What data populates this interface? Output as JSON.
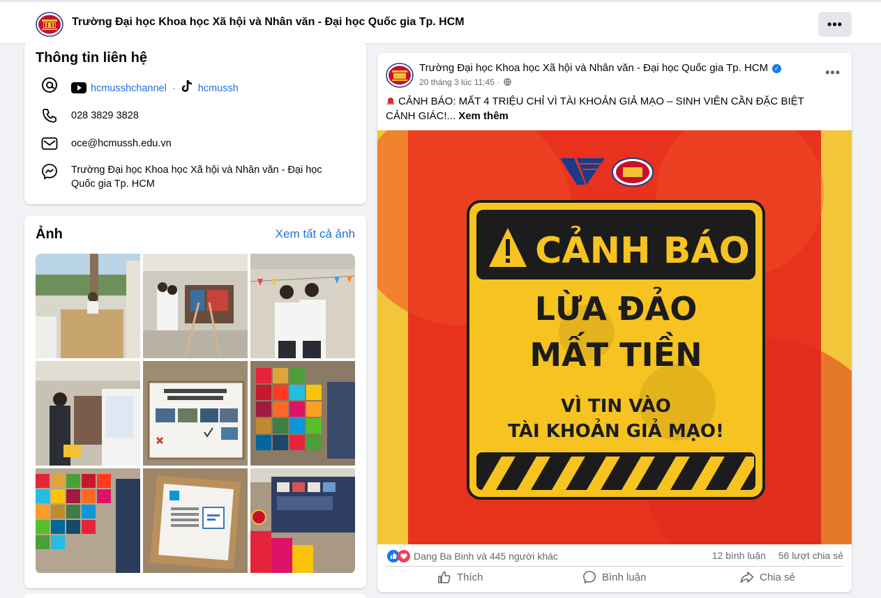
{
  "page": {
    "name": "Trường Đại học Khoa học Xã hội và Nhân văn - Đại học Quốc gia Tp. HCM",
    "more": "•••"
  },
  "contact": {
    "heading": "Thông tin liên hệ",
    "youtube": "hcmusshchannel",
    "separator": "·",
    "tiktok": "hcmussh",
    "phone": "028 3829 3828",
    "email": "oce@hcmussh.edu.vn",
    "messenger_line1": "Trường Đại học Khoa học Xã hội và Nhân văn - Đại học",
    "messenger_line2": "Quốc gia Tp. HCM"
  },
  "photos": {
    "heading": "Ảnh",
    "see_all": "Xem tất cả ảnh"
  },
  "post": {
    "author": "Trường Đại học Khoa học Xã hội và Nhân văn - Đại học Quốc gia Tp. HCM",
    "verified_mark": "✓",
    "date": "20 tháng 3 lúc 11:45 ·",
    "text": "CẢNH BÁO: MẤT 4 TRIỆU CHỈ VÌ TÀI KHOẢN GIẢ MẠO – SINH VIÊN CẦN ĐẶC BIỆT CẢNH GIÁC!...",
    "see_more": "Xem thêm",
    "more": "•••",
    "image": {
      "line1": "CẢNH BÁO",
      "line2": "LỪA ĐẢO",
      "line3": "MẤT TIỀN",
      "line4": "VÌ TIN VÀO",
      "line5": "TÀI KHOẢN GIẢ MẠO!"
    },
    "reactions": "Dang Ba Binh và 445 người khác",
    "comments": "12 bình luận",
    "shares": "56 lượt chia sẻ",
    "actions": {
      "like": "Thích",
      "comment": "Bình luận",
      "share": "Chia sẻ"
    }
  },
  "colors": {
    "link": "#216fdb",
    "facebook_blue": "#1877f2",
    "warning_yellow": "#f3c63a",
    "poster_red": "#e8321e"
  }
}
